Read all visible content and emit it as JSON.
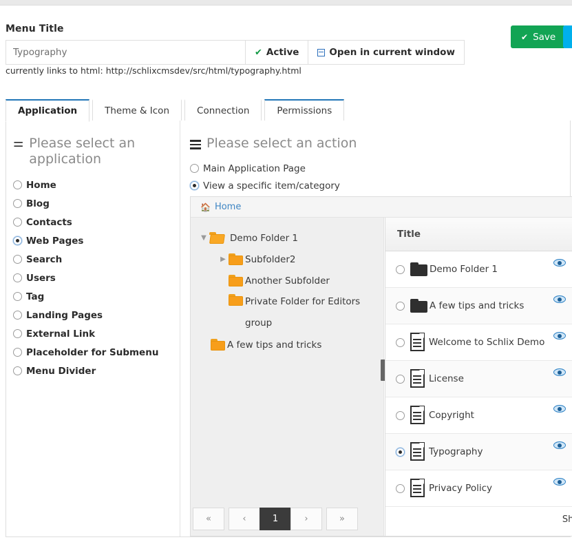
{
  "header": {
    "menu_title_label": "Menu Title",
    "title_value": "Typography",
    "title_placeholder": "Typography",
    "active_label": "Active",
    "window_label": "Open in current window",
    "links_note": "currently links to html: http://schlixcmsdev/src/html/typography.html",
    "save_label": "Save",
    "accent_green": "#12a454",
    "accent_blue": "#00b0ec"
  },
  "tabs": [
    {
      "label": "Application",
      "state": "active"
    },
    {
      "label": "Theme & Icon",
      "state": "normal"
    },
    {
      "label": "Connection",
      "state": "normal"
    },
    {
      "label": "Permissions",
      "state": "hovered"
    }
  ],
  "left": {
    "heading": "Please select an application",
    "icon": "puzzle-piece-icon",
    "items": [
      {
        "label": "Home",
        "selected": false
      },
      {
        "label": "Blog",
        "selected": false
      },
      {
        "label": "Contacts",
        "selected": false
      },
      {
        "label": "Web Pages",
        "selected": true
      },
      {
        "label": "Search",
        "selected": false
      },
      {
        "label": "Users",
        "selected": false
      },
      {
        "label": "Tag",
        "selected": false
      },
      {
        "label": "Landing Pages",
        "selected": false
      },
      {
        "label": "External Link",
        "selected": false
      },
      {
        "label": "Placeholder for Submenu",
        "selected": false
      },
      {
        "label": "Menu Divider",
        "selected": false
      }
    ]
  },
  "right": {
    "heading": "Please select an action",
    "icon": "hamburger-icon",
    "actions": [
      {
        "label": "Main Application Page",
        "selected": false
      },
      {
        "label": "View a specific item/category",
        "selected": true
      }
    ],
    "breadcrumb": {
      "icon": "home-icon",
      "label": "Home"
    },
    "tree": [
      {
        "label": "Demo Folder 1",
        "depth": 0,
        "caret": "down",
        "folder": "open"
      },
      {
        "label": "Subfolder2",
        "depth": 1,
        "caret": "right",
        "folder": "closed"
      },
      {
        "label": "Another Subfolder",
        "depth": 1,
        "caret": "none",
        "folder": "closed"
      },
      {
        "label": "Private Folder for Editors group",
        "depth": 1,
        "caret": "none",
        "folder": "closed"
      },
      {
        "label": "A few tips and tricks",
        "depth": 0,
        "caret": "none",
        "folder": "closed"
      }
    ],
    "list": {
      "column_header": "Title",
      "rows": [
        {
          "title": "Demo Folder 1",
          "type": "folder",
          "selected": false
        },
        {
          "title": "A few tips and tricks",
          "type": "folder",
          "selected": false
        },
        {
          "title": "Welcome to Schlix Demo",
          "type": "document",
          "selected": false
        },
        {
          "title": "License",
          "type": "document",
          "selected": false
        },
        {
          "title": "Copyright",
          "type": "document",
          "selected": false
        },
        {
          "title": "Typography",
          "type": "document",
          "selected": true
        },
        {
          "title": "Privacy Policy",
          "type": "document",
          "selected": false
        }
      ],
      "preview_icon": "eye-icon"
    },
    "pager": {
      "first": "«",
      "prev": "‹",
      "current": "1",
      "next": "›",
      "last": "»",
      "show_label": "Show"
    }
  }
}
